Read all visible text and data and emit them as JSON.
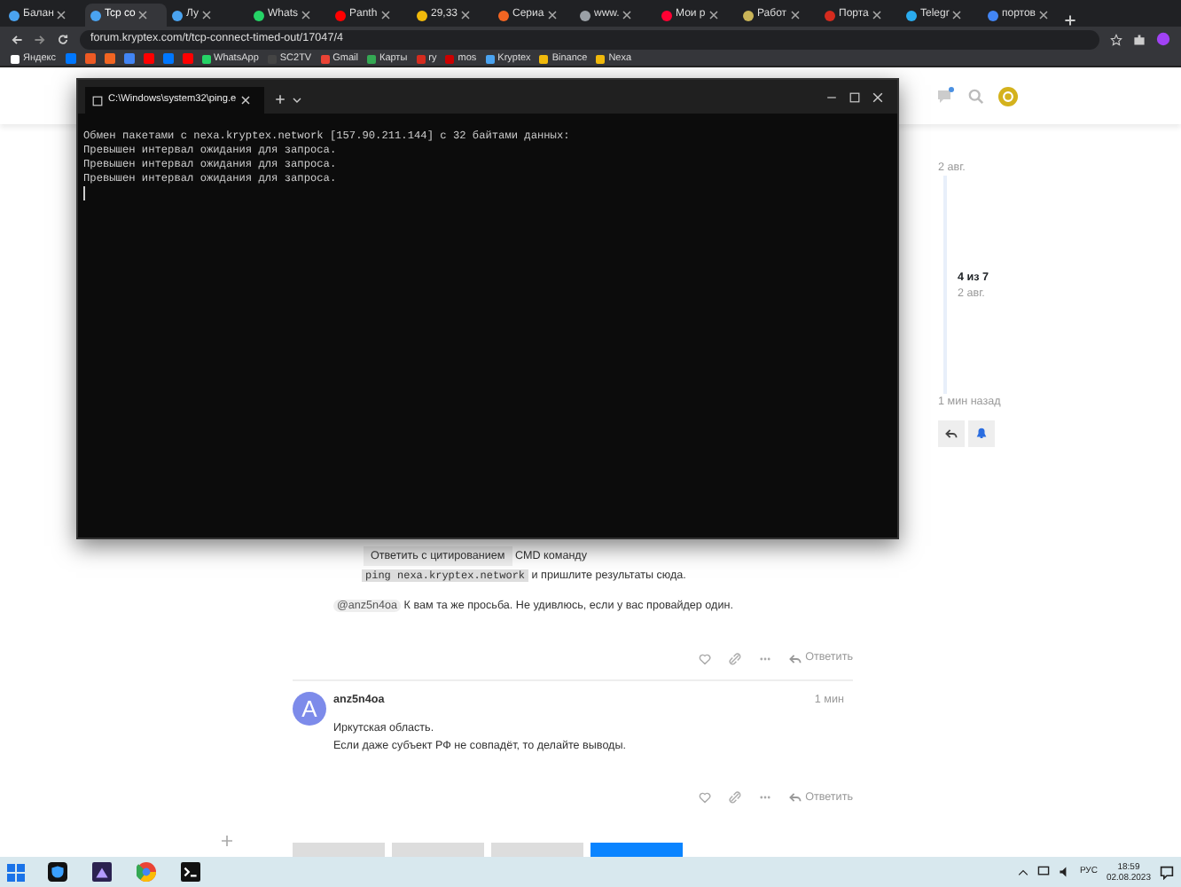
{
  "browser": {
    "tabs": [
      {
        "title": "Балан",
        "color": "#4aa3f0",
        "selected": false
      },
      {
        "title": "Tcp co",
        "color": "#4aa3f0",
        "selected": true
      },
      {
        "title": "Лу",
        "color": "#4aa3f0",
        "selected": false
      },
      {
        "title": "Whats",
        "color": "#25d366",
        "selected": false
      },
      {
        "title": "Panth",
        "color": "#ff0000",
        "selected": false
      },
      {
        "title": "29,33",
        "color": "#f0b90b",
        "selected": false
      },
      {
        "title": "Сериа",
        "color": "#f26522",
        "selected": false
      },
      {
        "title": "www.",
        "color": "#9aa0a6",
        "selected": false
      },
      {
        "title": "Мои р",
        "color": "#ff0033",
        "selected": false
      },
      {
        "title": "Работ",
        "color": "#c9b458",
        "selected": false
      },
      {
        "title": "Порта",
        "color": "#d52b1e",
        "selected": false
      },
      {
        "title": "Telegr",
        "color": "#2aabee",
        "selected": false
      },
      {
        "title": "портов",
        "color": "#4285f4",
        "selected": false
      }
    ],
    "url": "forum.kryptex.com/t/tcp-connect-timed-out/17047/4",
    "bookmarks": [
      {
        "kind": "labeled",
        "label": "Яндекс",
        "color": "#ffffff"
      },
      {
        "kind": "icon",
        "color": "#0077ff"
      },
      {
        "kind": "icon",
        "color": "#ee5a24"
      },
      {
        "kind": "icon",
        "color": "#f26522"
      },
      {
        "kind": "icon",
        "color": "#4285f4"
      },
      {
        "kind": "icon",
        "color": "#ff0000"
      },
      {
        "kind": "icon",
        "color": "#0077ff"
      },
      {
        "kind": "icon",
        "color": "#ff0000"
      },
      {
        "kind": "labeled",
        "label": "WhatsApp",
        "color": "#25d366"
      },
      {
        "kind": "labeled",
        "label": "SC2TV",
        "color": "#444444"
      },
      {
        "kind": "labeled",
        "label": "Gmail",
        "color": "#ea4335"
      },
      {
        "kind": "labeled",
        "label": "Карты",
        "color": "#34a853"
      },
      {
        "kind": "labeled",
        "label": "ry",
        "color": "#d52b1e"
      },
      {
        "kind": "labeled",
        "label": "mos",
        "color": "#cc0000"
      },
      {
        "kind": "labeled",
        "label": "Kryptex",
        "color": "#4aa3f0"
      },
      {
        "kind": "labeled",
        "label": "Binance",
        "color": "#f0b90b"
      },
      {
        "kind": "labeled",
        "label": "Nexa",
        "color": "#f0b90b"
      }
    ]
  },
  "terminal": {
    "tab_title": "C:\\Windows\\system32\\ping.e",
    "lines": [
      "Обмен пакетами с nexa.kryptex.network [157.90.211.144] с 32 байтами данных:",
      "Превышен интервал ожидания для запроса.",
      "Превышен интервал ожидания для запроса.",
      "Превышен интервал ожидания для запроса."
    ]
  },
  "timeline": {
    "start_date": "2 авг.",
    "position": "4 из 7",
    "position_date": "2 авг.",
    "end_label": "1 мин назад"
  },
  "posts": [
    {
      "quote_button": "Ответить с цитированием",
      "fragment": "CMD команду",
      "code": "ping nexa.kryptex.network",
      "code_after": " и пришлите результаты сюда.",
      "mention": "@anz5n4oa",
      "text": " К вам та же просьба. Не удивлюсь, если у вас провайдер один.",
      "reply": "Ответить"
    },
    {
      "author": "anz5n4oa",
      "avatar_letter": "A",
      "time": "1 мин",
      "lines": [
        "Иркутская область.",
        "Если даже субъект РФ не совпадёт, то делайте выводы."
      ],
      "reply": "Ответить"
    }
  ],
  "taskbar": {
    "language": "РУС",
    "time": "18:59",
    "date": "02.08.2023"
  }
}
